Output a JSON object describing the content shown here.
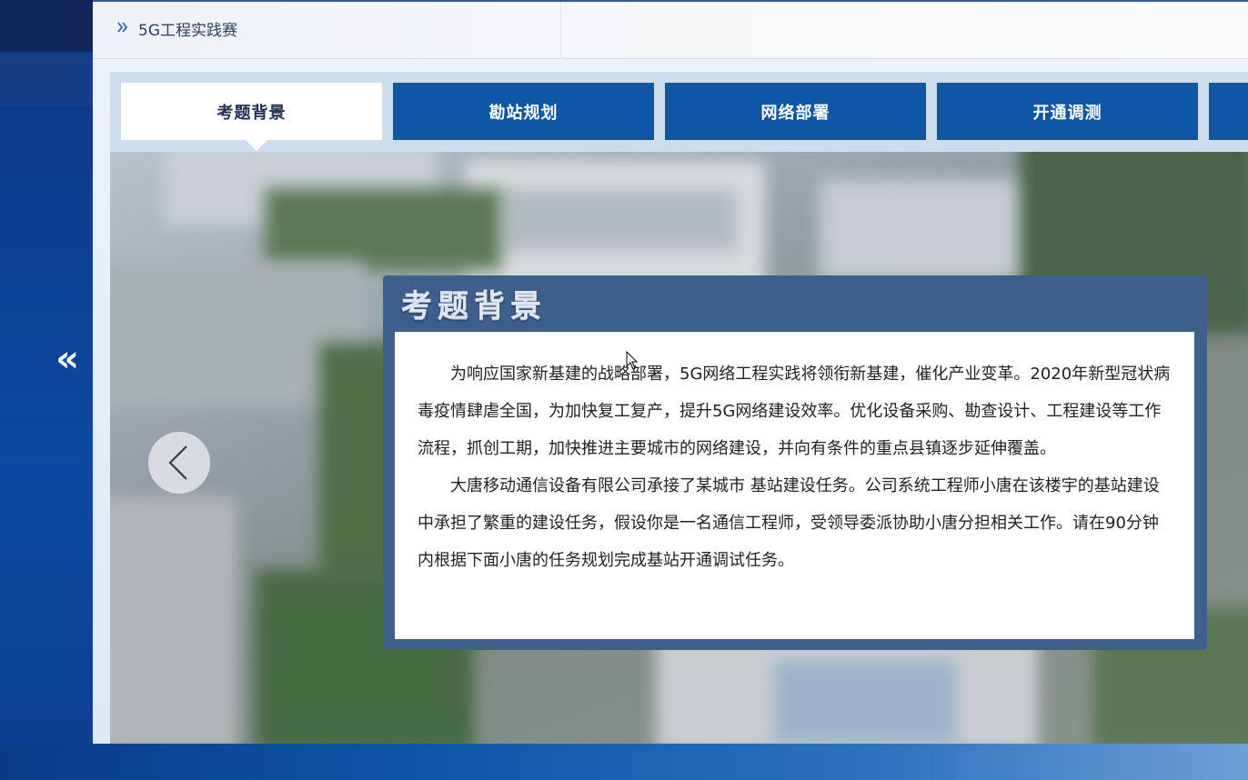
{
  "breadcrumb": {
    "icon": "double-chevron-right-icon",
    "text": "5G工程实践赛"
  },
  "sidebar": {
    "collapse_glyph": "«"
  },
  "tabs": [
    {
      "label": "考题背景",
      "active": true
    },
    {
      "label": "勘站规划",
      "active": false
    },
    {
      "label": "网络部署",
      "active": false
    },
    {
      "label": "开通调测",
      "active": false
    },
    {
      "label": "",
      "active": false
    }
  ],
  "card": {
    "title": "考题背景",
    "paragraphs": [
      "为响应国家新基建的战略部署，5G网络工程实践将领衔新基建，催化产业变革。2020年新型冠状病毒疫情肆虐全国，为加快复工复产，提升5G网络建设效率。优化设备采购、勘查设计、工程建设等工作流程，抓创工期，加快推进主要城市的网络建设，并向有条件的重点县镇逐步延伸覆盖。",
      "大唐移动通信设备有限公司承接了某城市 基站建设任务。公司系统工程师小唐在该楼宇的基站建设中承担了繁重的建设任务，假设你是一名通信工程师，受领导委派协助小唐分担相关工作。请在90分钟内根据下面小唐的任务规划完成基站开通调试任务。"
    ]
  },
  "colors": {
    "tab_bg": "#0f56a6",
    "tab_active_bg": "#ffffff",
    "card_frame": "#3d5f8c"
  }
}
